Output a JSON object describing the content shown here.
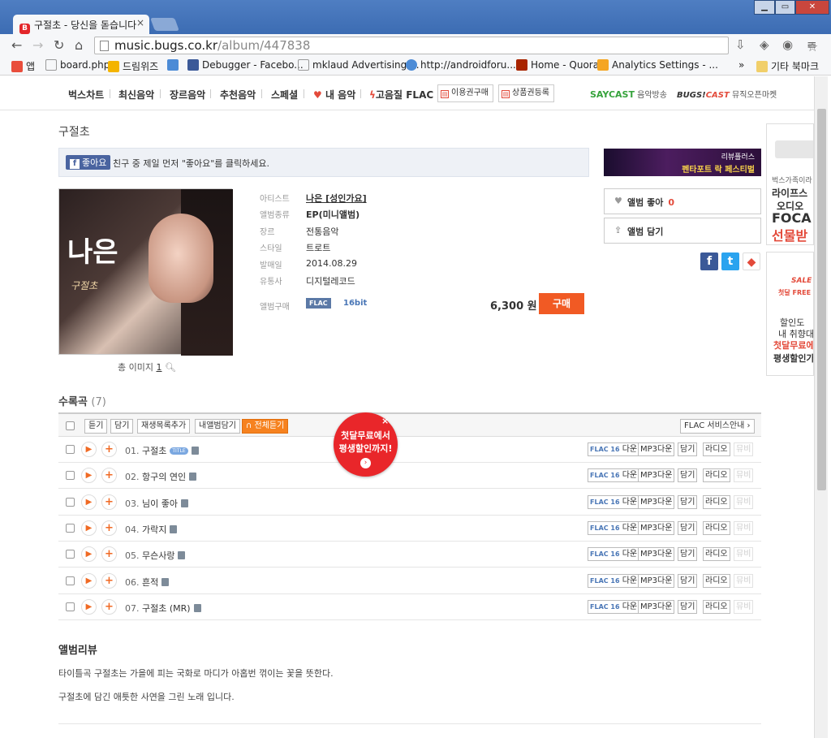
{
  "browser": {
    "tab_title": "구절초 - 당신을 돋습니다",
    "url_host": "music.bugs.co.kr",
    "url_path": "/album/447838",
    "bookmarks": [
      {
        "label": "앱",
        "color": "#e94e3c"
      },
      {
        "label": "board.php",
        "color": "#ffffff"
      },
      {
        "label": "드림위즈",
        "color": "#f4b400"
      },
      {
        "label": "",
        "color": "#4c8bd6"
      },
      {
        "label": "Debugger - Facebo...",
        "color": "#3b5998"
      },
      {
        "label": "mklaud Advertising ...",
        "color": "#ffffff"
      },
      {
        "label": "http://androidforu...",
        "color": "#4c8bd6"
      },
      {
        "label": "Home - Quora",
        "color": "#a82400"
      },
      {
        "label": "Analytics Settings - ...",
        "color": "#f5a623"
      }
    ],
    "bookmarks_more": "»",
    "other_bookmarks": "기타 북마크"
  },
  "gnb": {
    "items": [
      "벅스차트",
      "최신음악",
      "장르음악",
      "추천음악",
      "스페셜",
      "내 음악",
      "고음질 FLAC"
    ],
    "box1": "이용권구매",
    "box2": "상품권등록",
    "saycast_logo": "SAYCAST",
    "saycast_text": "음악방송",
    "bugscast_logo1": "BUGS!",
    "bugscast_logo2": "CAST",
    "bugscast_text": "뮤직오픈마켓"
  },
  "album": {
    "title": "구절초",
    "fb_like": "좋아요",
    "fb_text": "친구 중 제일 먼저 \"좋아요\"를 클릭하세요.",
    "cover_title": "나은",
    "cover_sub": "구절초",
    "image_count_label": "총 이미지",
    "image_count": "1",
    "meta": [
      {
        "k": "아티스트",
        "v": "나은 [성인가요]"
      },
      {
        "k": "앨범종류",
        "v": "EP(미니앨범)"
      },
      {
        "k": "장르",
        "v": "전통음악"
      },
      {
        "k": "스타일",
        "v": "트로트"
      },
      {
        "k": "발매일",
        "v": "2014.08.29"
      },
      {
        "k": "유통사",
        "v": "디지털레코드"
      }
    ],
    "purchase_label": "앨범구매",
    "flac": "FLAC",
    "bit": "16bit",
    "price": "6,300 원",
    "buy": "구매"
  },
  "sidebar": {
    "banner_top": "리뷰플러스",
    "banner_bottom": "펜타포트 락 페스티벌",
    "like": "앨범 좋아",
    "like_count": "0",
    "save": "앨범 담기",
    "ad1": [
      "벅스가족이라",
      "라이프스",
      "오디오",
      "FOCA",
      "선물받"
    ],
    "ad2": [
      "SALE",
      "첫달 FREE",
      "할인도",
      "내 취향대",
      "첫달무료에",
      "평생할인가"
    ]
  },
  "tracks": {
    "heading": "수록곡",
    "count": "(7)",
    "controls": [
      "듣기",
      "담기",
      "재생목록추가",
      "내앨범담기",
      "전체듣기"
    ],
    "flac_info": "FLAC 서비스안내 ›",
    "items": [
      {
        "num": "01.",
        "name": "구절초",
        "title": true
      },
      {
        "num": "02.",
        "name": "항구의 연인",
        "title": false
      },
      {
        "num": "03.",
        "name": "님이 좋아",
        "title": false
      },
      {
        "num": "04.",
        "name": "가락지",
        "title": false
      },
      {
        "num": "05.",
        "name": "무슨사랑",
        "title": false
      },
      {
        "num": "06.",
        "name": "흔적",
        "title": false
      },
      {
        "num": "07.",
        "name": "구절초 (MR)",
        "title": false
      }
    ],
    "title_badge": "TITLE",
    "row_buttons": {
      "flac": "FLAC 16",
      "down": "다운",
      "mp3": "MP3",
      "add": "담기",
      "radio": "라디오",
      "mv": "뮤비"
    }
  },
  "promo": {
    "line1": "첫달무료에서",
    "line2": "평생할인까지!",
    "close": "×",
    "go": "›"
  },
  "review": {
    "heading": "앨범리뷰",
    "p1": "타이틀곡 구절초는 가을에 피는 국화로 마디가 아홉번 꺾이는 꽃을 뜻한다.",
    "p2": "구절초에 담긴 애틋한 사연을 그린 노래 입니다."
  },
  "colors": {
    "accent": "#f15a24",
    "browser_frame": "#3c6cb3"
  }
}
